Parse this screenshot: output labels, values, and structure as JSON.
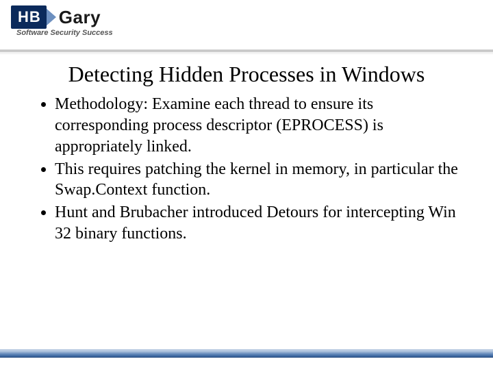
{
  "logo": {
    "box_text": "HB",
    "gary_text": "Gary",
    "tagline": "Software Security Success"
  },
  "title": "Detecting Hidden Processes in Windows",
  "bullets": [
    "Methodology: Examine each thread to ensure its corresponding process descriptor (EPROCESS) is appropriately linked.",
    "This requires patching the kernel in memory, in particular the Swap.Context function.",
    "Hunt and Brubacher introduced Detours for intercepting Win 32 binary functions."
  ]
}
